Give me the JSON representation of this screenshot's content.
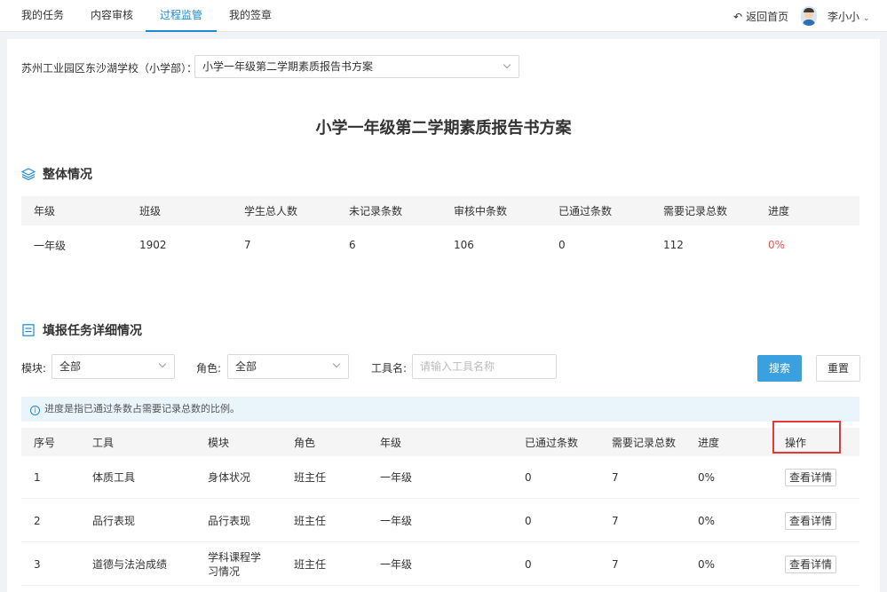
{
  "nav": {
    "tabs": [
      {
        "label": "我的任务"
      },
      {
        "label": "内容审核"
      },
      {
        "label": "过程监管"
      },
      {
        "label": "我的签章"
      }
    ],
    "active_tab": "过程监管",
    "back_home": "返回首页",
    "user_name": "李小小"
  },
  "plan": {
    "school_label": "苏州工业园区东沙湖学校（小学部）：",
    "selected_plan": "小学一年级第二学期素质报告书方案",
    "title": "小学一年级第二学期素质报告书方案"
  },
  "overview": {
    "section_title": "整体情况",
    "columns": [
      "年级",
      "班级",
      "学生总人数",
      "未记录条数",
      "审核中条数",
      "已通过条数",
      "需要记录总数",
      "进度"
    ],
    "row": [
      "一年级",
      "1902",
      "7",
      "6",
      "106",
      "0",
      "112",
      "0%"
    ]
  },
  "detail": {
    "section_title": "填报任务详细情况",
    "filters": {
      "module_label": "模块:",
      "module_value": "全部",
      "role_label": "角色:",
      "role_value": "全部",
      "tool_label": "工具名:",
      "tool_placeholder": "请输入工具名称",
      "search_button": "搜索",
      "reset_button": "重置"
    },
    "info_text": "进度是指已通过条数占需要记录总数的比例。",
    "columns": [
      "序号",
      "工具",
      "模块",
      "角色",
      "年级",
      "已通过条数",
      "需要记录总数",
      "进度",
      "操作"
    ],
    "rows": [
      {
        "no": "1",
        "tool": "体质工具",
        "module": "身体状况",
        "role": "班主任",
        "grade": "一年级",
        "passed": "0",
        "total": "7",
        "progress": "0%",
        "action": "查看详情"
      },
      {
        "no": "2",
        "tool": "品行表现",
        "module": "品行表现",
        "role": "班主任",
        "grade": "一年级",
        "passed": "0",
        "total": "7",
        "progress": "0%",
        "action": "查看详情"
      },
      {
        "no": "3",
        "tool": "道德与法治成绩",
        "module": "学科课程学习情况",
        "role": "班主任",
        "grade": "一年级",
        "passed": "0",
        "total": "7",
        "progress": "0%",
        "action": "查看详情"
      }
    ]
  },
  "colors": {
    "accent": "#1c8ad7",
    "primary_button": "#3aa0e0",
    "progress_red": "#ef5350",
    "highlight": "#e53935"
  }
}
